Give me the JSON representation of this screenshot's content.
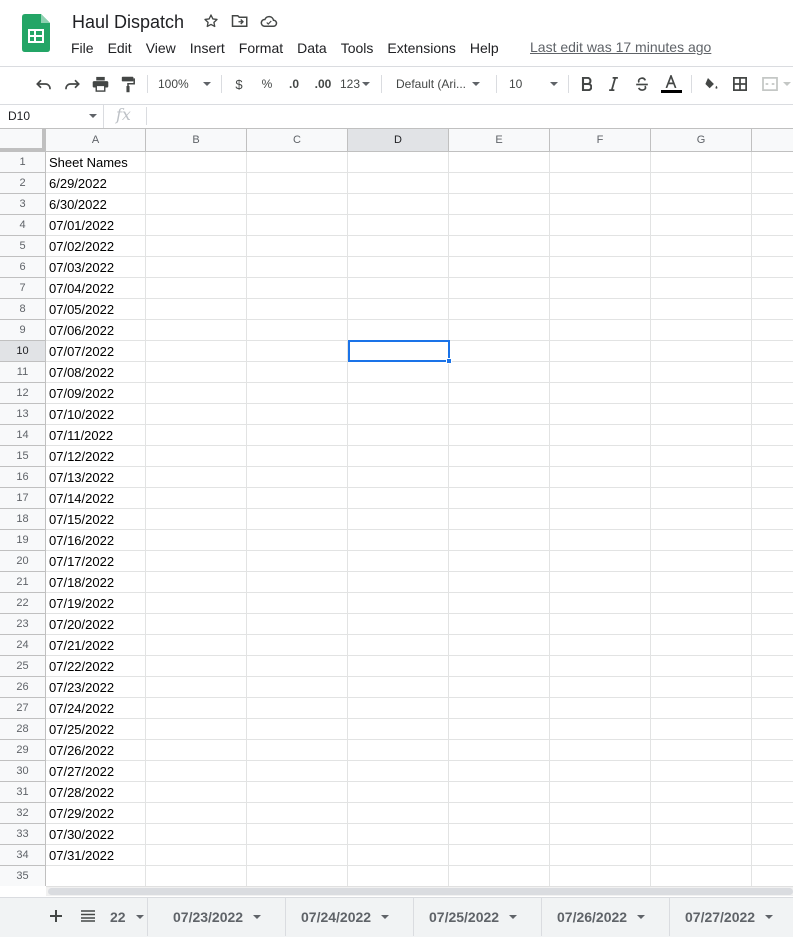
{
  "app": {
    "title": "Haul Dispatch",
    "last_edit": "Last edit was 17 minutes ago",
    "brand_color": "#23a566"
  },
  "menu": [
    "File",
    "Edit",
    "View",
    "Insert",
    "Format",
    "Data",
    "Tools",
    "Extensions",
    "Help"
  ],
  "toolbar": {
    "zoom": "100%",
    "currency": "$",
    "percent": "%",
    "decrease_decimal": ".0",
    "increase_decimal": ".00",
    "more_formats": "123",
    "font": "Default (Ari...",
    "font_size": "10",
    "icons": [
      "undo-icon",
      "redo-icon",
      "print-icon",
      "paint-format-icon",
      "bold-icon",
      "italic-icon",
      "strikethrough-icon",
      "text-color-icon",
      "fill-color-icon",
      "borders-icon",
      "merge-cells-icon"
    ]
  },
  "formula_bar": {
    "name_box": "D10",
    "fx": "fx",
    "value": ""
  },
  "grid": {
    "columns": [
      "A",
      "B",
      "C",
      "D",
      "E",
      "F",
      "G"
    ],
    "selected_column": "D",
    "selected_row": 10,
    "rows": [
      {
        "n": "1",
        "a": "Sheet Names"
      },
      {
        "n": "2",
        "a": "6/29/2022"
      },
      {
        "n": "3",
        "a": "6/30/2022"
      },
      {
        "n": "4",
        "a": "07/01/2022"
      },
      {
        "n": "5",
        "a": "07/02/2022"
      },
      {
        "n": "6",
        "a": "07/03/2022"
      },
      {
        "n": "7",
        "a": "07/04/2022"
      },
      {
        "n": "8",
        "a": "07/05/2022"
      },
      {
        "n": "9",
        "a": "07/06/2022"
      },
      {
        "n": "10",
        "a": "07/07/2022"
      },
      {
        "n": "11",
        "a": "07/08/2022"
      },
      {
        "n": "12",
        "a": "07/09/2022"
      },
      {
        "n": "13",
        "a": "07/10/2022"
      },
      {
        "n": "14",
        "a": "07/11/2022"
      },
      {
        "n": "15",
        "a": "07/12/2022"
      },
      {
        "n": "16",
        "a": "07/13/2022"
      },
      {
        "n": "17",
        "a": "07/14/2022"
      },
      {
        "n": "18",
        "a": "07/15/2022"
      },
      {
        "n": "19",
        "a": "07/16/2022"
      },
      {
        "n": "20",
        "a": "07/17/2022"
      },
      {
        "n": "21",
        "a": "07/18/2022"
      },
      {
        "n": "22",
        "a": "07/19/2022"
      },
      {
        "n": "23",
        "a": "07/20/2022"
      },
      {
        "n": "24",
        "a": "07/21/2022"
      },
      {
        "n": "25",
        "a": "07/22/2022"
      },
      {
        "n": "26",
        "a": "07/23/2022"
      },
      {
        "n": "27",
        "a": "07/24/2022"
      },
      {
        "n": "28",
        "a": "07/25/2022"
      },
      {
        "n": "29",
        "a": "07/26/2022"
      },
      {
        "n": "30",
        "a": "07/27/2022"
      },
      {
        "n": "31",
        "a": "07/28/2022"
      },
      {
        "n": "32",
        "a": "07/29/2022"
      },
      {
        "n": "33",
        "a": "07/30/2022"
      },
      {
        "n": "34",
        "a": "07/31/2022"
      },
      {
        "n": "35",
        "a": ""
      }
    ]
  },
  "sheet_tabs": [
    "22",
    "07/23/2022",
    "07/24/2022",
    "07/25/2022",
    "07/26/2022",
    "07/27/2022"
  ]
}
